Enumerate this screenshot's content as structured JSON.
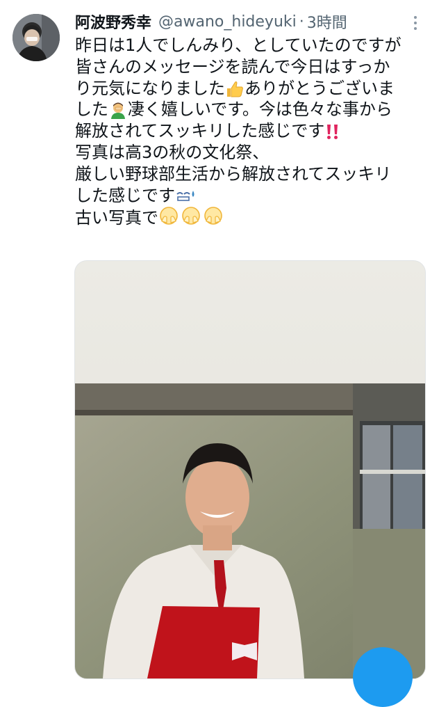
{
  "tweet": {
    "display_name": "阿波野秀幸",
    "handle": "@awano_hideyuki",
    "separator": "·",
    "time": "3時間",
    "lines": [
      {
        "text": "昨日は1人でしんみり、としていたのですが"
      },
      {
        "text": "皆さんのメッセージを読んで今日はすっか"
      },
      {
        "text": "り元気になりました",
        "emoji": "thumbs-up-icon",
        "after": "ありがとうございま"
      },
      {
        "text": "した",
        "emoji": "man-facepalming-icon",
        "after": "凄く嬉しいです。今は色々な事から"
      },
      {
        "text": "解放されてスッキリした感じです",
        "emoji": "double-exclamation-icon"
      },
      {
        "text": "写真は高3の秋の文化祭、"
      },
      {
        "text": "厳しい野球部生活から解放されてスッキリ"
      },
      {
        "text": "した感じです",
        "emoji": "sweat-smile-icon"
      },
      {
        "text": "古い写真で",
        "emoji": "facepalm-icon-x3"
      }
    ]
  },
  "colors": {
    "text": "#0f1419",
    "secondary": "#536471",
    "accent": "#1d9bf0",
    "exclamation": "#e0245e"
  },
  "media": {
    "alt": "高3の秋の文化祭の写真"
  }
}
